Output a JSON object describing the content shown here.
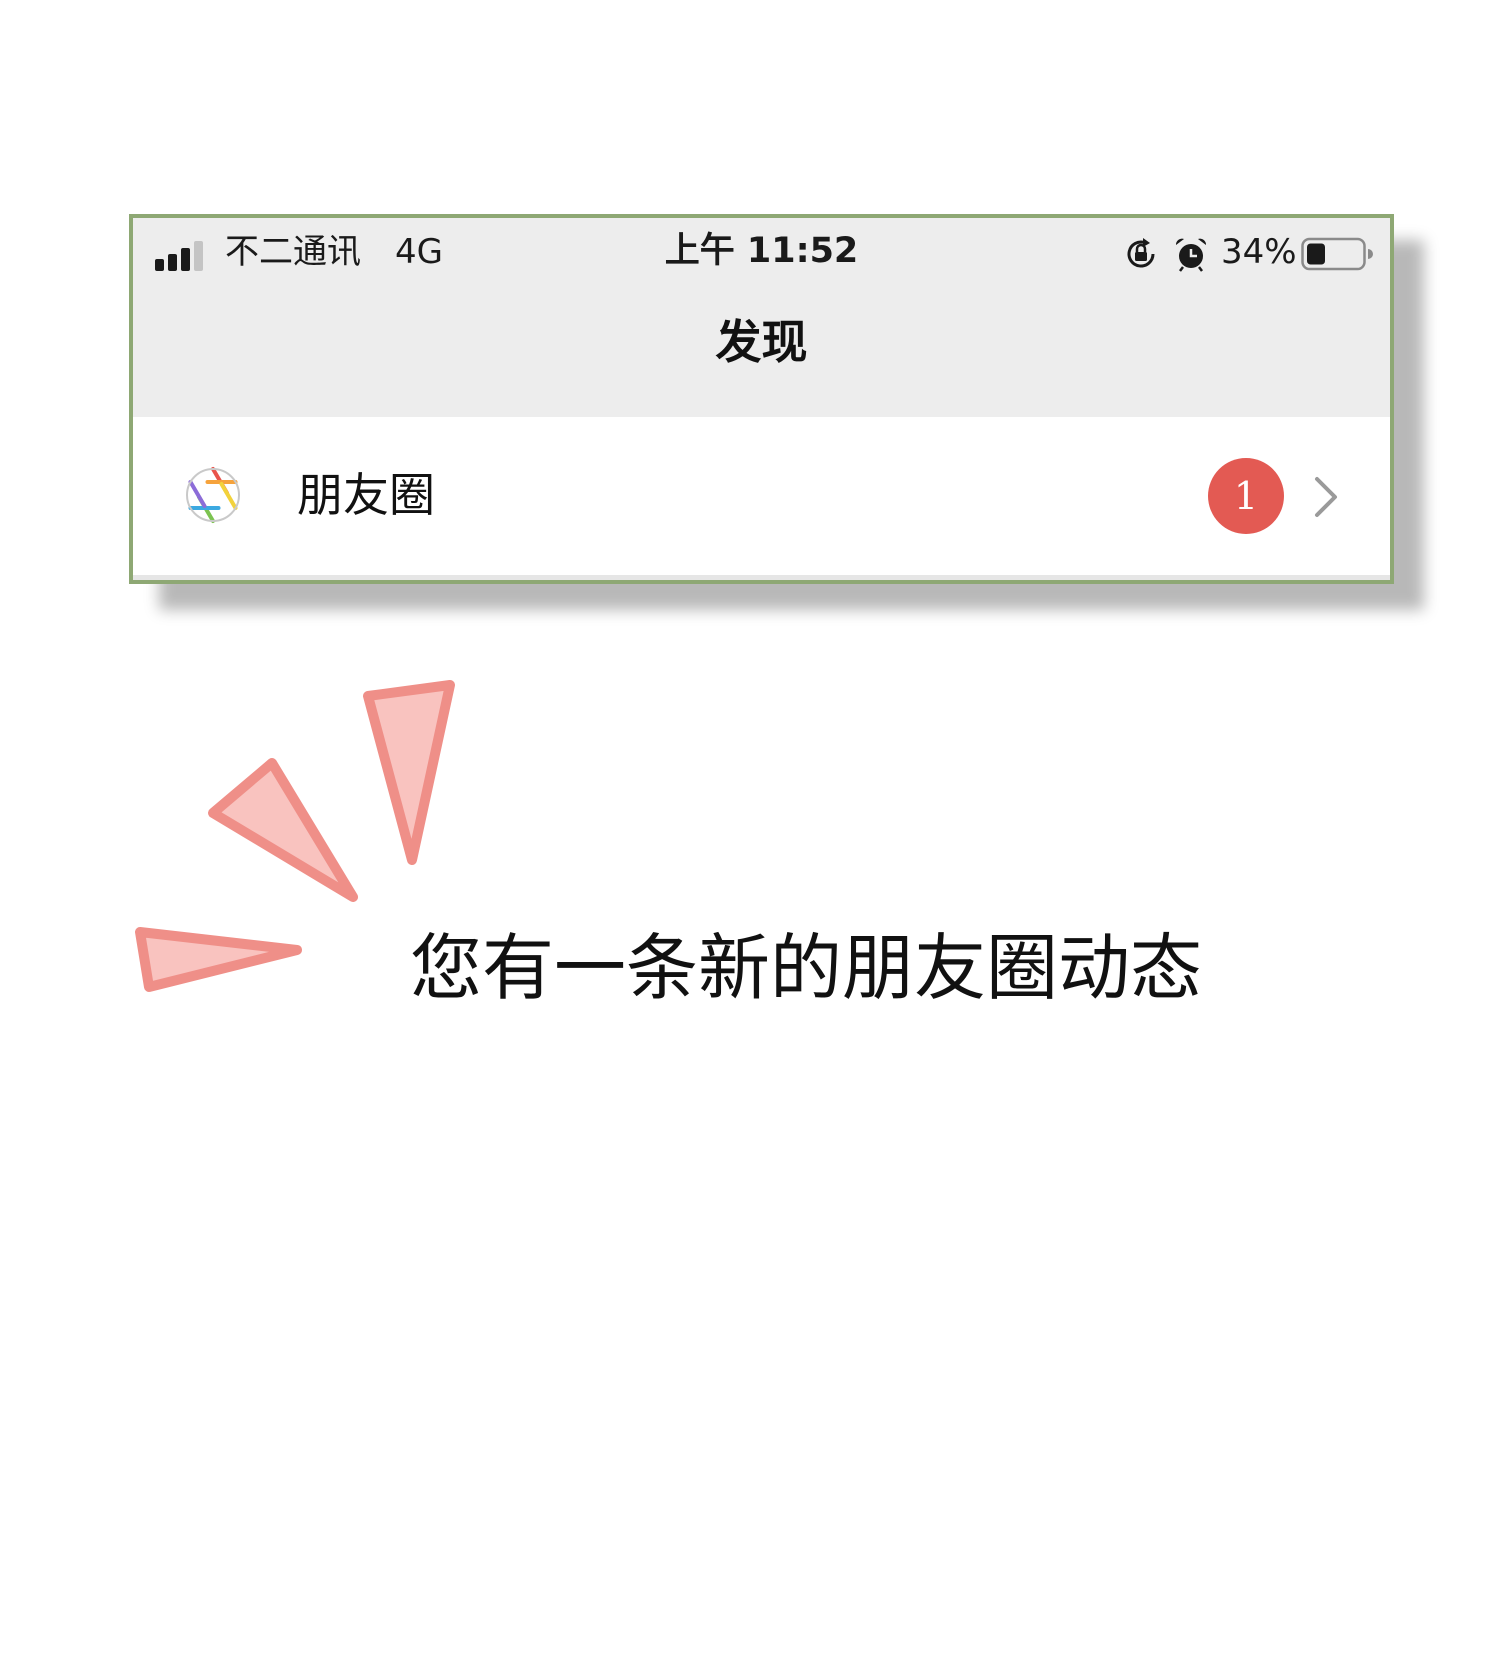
{
  "status_bar": {
    "carrier": "不二通讯",
    "network": "4G",
    "time": "上午 11:52",
    "battery_percent_label": "34%",
    "battery_level": 0.34,
    "signal_bars_filled": 3,
    "signal_bars_total": 4,
    "icons": [
      "rotation-lock-icon",
      "alarm-icon",
      "battery-icon"
    ]
  },
  "nav": {
    "title": "发现"
  },
  "row": {
    "label": "朋友圈",
    "icon": "moments-icon",
    "badge_count": "1",
    "accessory_icon": "chevron-right-icon"
  },
  "caption": "您有一条新的朋友圈动态",
  "colors": {
    "card_border": "#8ea874",
    "header_bg": "#ededed",
    "badge": "#e35a53",
    "burst_fill": "#f9c3bf",
    "burst_stroke": "#ef8f88"
  }
}
